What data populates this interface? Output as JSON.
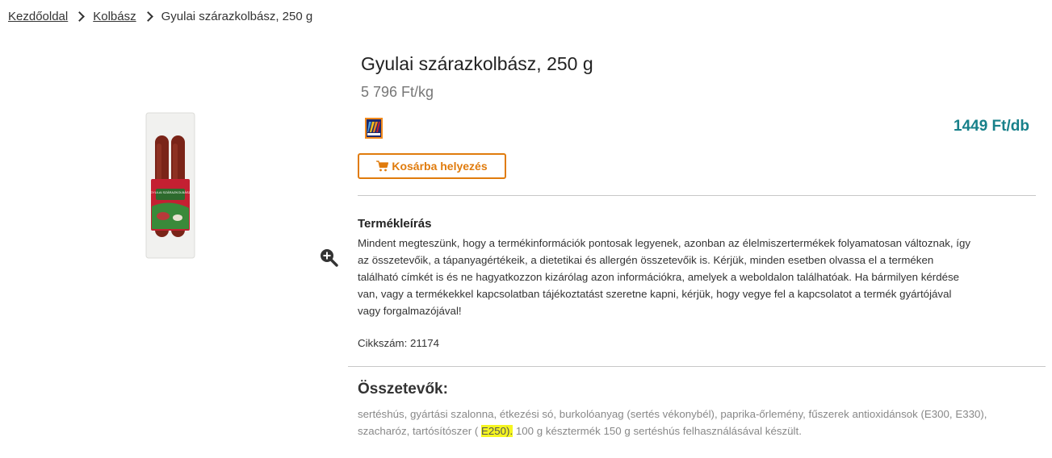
{
  "breadcrumb": {
    "home": "Kezdőoldal",
    "category": "Kolbász",
    "current": "Gyulai szárazkolbász, 250 g"
  },
  "product": {
    "title": "Gyulai szárazkolbász, 250 g",
    "unit_price": "5 796 Ft/kg",
    "price": "1449 Ft/db",
    "store_logo_icon": "aldi-logo-icon",
    "image_icon": "sausage-package-image",
    "label_text": "GYULAI SZÁRAZKOLBÁSZ"
  },
  "actions": {
    "add_to_cart": "Kosárba helyezés",
    "add_to_cart_icon": "cart-icon",
    "zoom_icon": "zoom-in-icon"
  },
  "description": {
    "heading": "Termékleírás",
    "text": "Mindent megteszünk, hogy a termékinformációk pontosak legyenek, azonban az élelmiszertermékek folyamatosan változnak, így az összetevőik, a tápanyagértékeik, a dietetikai és allergén összetevőik is. Kérjük, minden esetben olvassa el a terméken található címkét is és ne hagyatkozzon kizárólag azon információkra, amelyek a weboldalon találhatóak. Ha bármilyen kérdése van, vagy a termékekkel kapcsolatban tájékoztatást szeretne kapni, kérjük, hogy vegye fel a kapcsolatot a termék gyártójával vagy forgalmazójával!",
    "sku": "Cikkszám: 21174"
  },
  "ingredients": {
    "heading": "Összetevők:",
    "text_before": "sertéshús, gyártási szalonna, étkezési só, burkolóanyag (sertés vékonybél), paprika-őrlemény, fűszerek antioxidánsok (E300, E330), szacharóz, tartósítószer ( ",
    "highlight": "E250).",
    "text_after": " 100 g késztermék 150 g sertéshús felhasználásával készült."
  },
  "colors": {
    "price": "#17808a",
    "accent": "#e07b0c",
    "highlight": "#f5f520"
  }
}
